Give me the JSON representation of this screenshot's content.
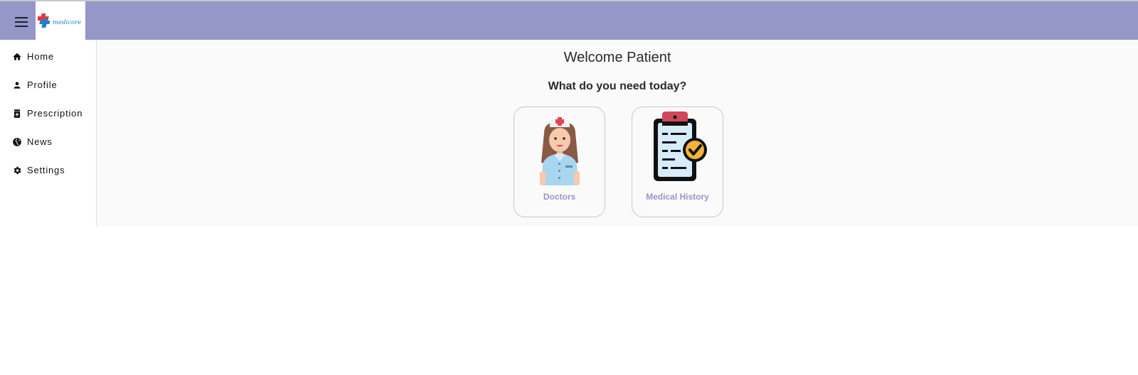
{
  "header": {
    "menu_icon": "menu-icon",
    "logo_text": "medicore",
    "background": "#9597c6"
  },
  "sidebar": {
    "items": [
      {
        "label": "Home",
        "icon": "home-icon"
      },
      {
        "label": "Profile",
        "icon": "person-icon"
      },
      {
        "label": "Prescription",
        "icon": "medication-icon"
      },
      {
        "label": "News",
        "icon": "globe-icon"
      },
      {
        "label": "Settings",
        "icon": "gear-icon"
      }
    ]
  },
  "main": {
    "welcome": "Welcome Patient",
    "question": "What do you need today?",
    "cards": [
      {
        "label": "Doctors",
        "icon": "nurse-icon"
      },
      {
        "label": "Medical History",
        "icon": "clipboard-check-icon"
      }
    ]
  },
  "colors": {
    "accent": "#9597c6",
    "content_bg": "#fafafa"
  }
}
